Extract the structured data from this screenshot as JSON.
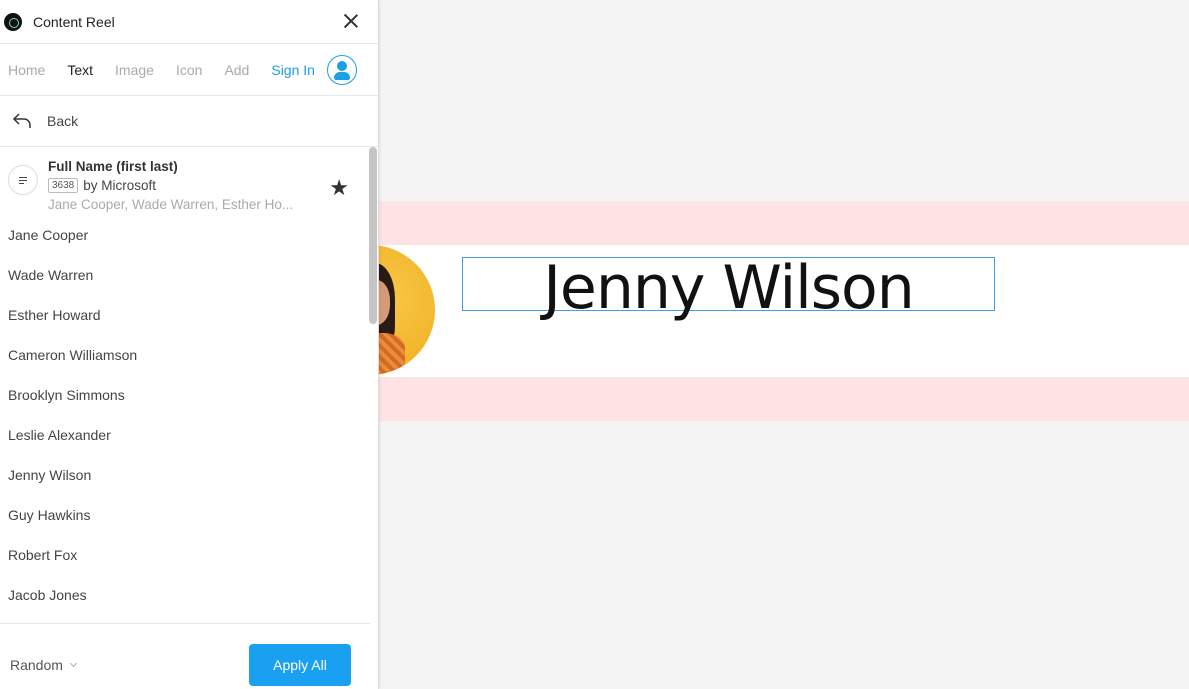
{
  "app": {
    "title": "Content Reel"
  },
  "tabs": [
    {
      "label": "Home",
      "active": false
    },
    {
      "label": "Text",
      "active": true
    },
    {
      "label": "Image",
      "active": false
    },
    {
      "label": "Icon",
      "active": false
    },
    {
      "label": "Add",
      "active": false
    }
  ],
  "signin": {
    "label": "Sign In"
  },
  "back": {
    "label": "Back"
  },
  "source": {
    "title": "Full Name (first last)",
    "count": "3638",
    "author": "by Microsoft",
    "preview": "Jane Cooper, Wade Warren, Esther Ho..."
  },
  "items": [
    "Jane Cooper",
    "Wade Warren",
    "Esther Howard",
    "Cameron Williamson",
    "Brooklyn Simmons",
    "Leslie Alexander",
    "Jenny Wilson",
    "Guy Hawkins",
    "Robert Fox",
    "Jacob Jones"
  ],
  "footer": {
    "mode": "Random",
    "apply_label": "Apply All"
  },
  "canvas": {
    "selected_text": "Jenny Wilson"
  },
  "colors": {
    "accent": "#1aa0f0",
    "band": "#fde3e3",
    "selection": "#3aa0e8"
  }
}
